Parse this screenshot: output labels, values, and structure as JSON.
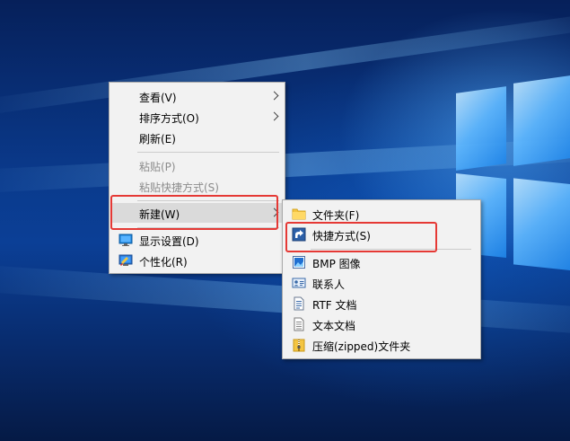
{
  "context_menu": {
    "items": [
      {
        "label": "查看(V)"
      },
      {
        "label": "排序方式(O)"
      },
      {
        "label": "刷新(E)"
      },
      {
        "label": "粘贴(P)"
      },
      {
        "label": "粘贴快捷方式(S)"
      },
      {
        "label": "新建(W)"
      },
      {
        "label": "显示设置(D)"
      },
      {
        "label": "个性化(R)"
      }
    ]
  },
  "new_submenu": {
    "items": [
      {
        "label": "文件夹(F)",
        "icon": "folder-icon"
      },
      {
        "label": "快捷方式(S)",
        "icon": "shortcut-icon"
      },
      {
        "label": "BMP 图像",
        "icon": "bmp-image-icon"
      },
      {
        "label": "联系人",
        "icon": "contact-icon"
      },
      {
        "label": "RTF 文档",
        "icon": "rtf-document-icon"
      },
      {
        "label": "文本文档",
        "icon": "text-document-icon"
      },
      {
        "label": "压缩(zipped)文件夹",
        "icon": "zip-folder-icon"
      }
    ]
  },
  "colors": {
    "highlight_border": "#e53935",
    "menu_background": "#f2f2f2",
    "selected_background": "#dadada",
    "desktop_blue": "#0b3f96"
  }
}
